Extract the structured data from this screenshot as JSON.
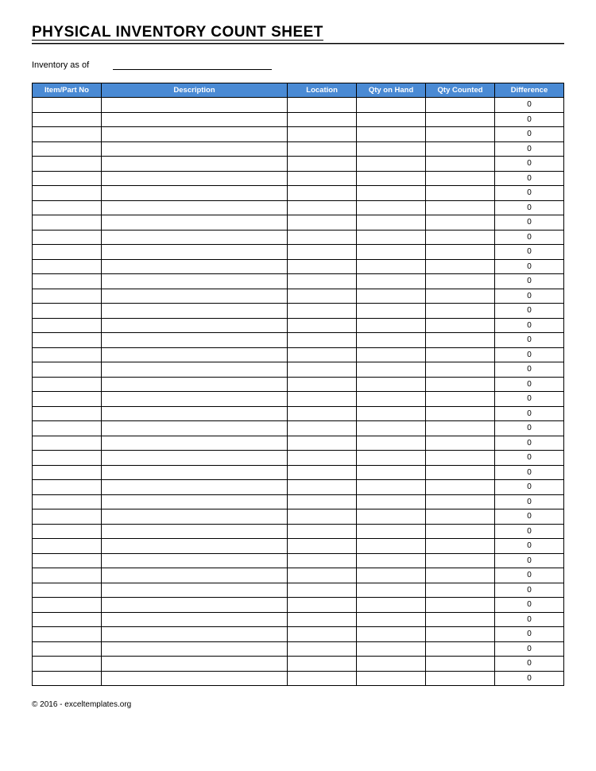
{
  "header": {
    "title": "PHYSICAL INVENTORY COUNT SHEET",
    "asof_label": "Inventory as of",
    "asof_value": ""
  },
  "table": {
    "columns": [
      "Item/Part No",
      "Description",
      "Location",
      "Qty on Hand",
      "Qty Counted",
      "Difference"
    ],
    "rows": [
      {
        "item": "",
        "desc": "",
        "loc": "",
        "qoh": "",
        "qc": "",
        "diff": "0"
      },
      {
        "item": "",
        "desc": "",
        "loc": "",
        "qoh": "",
        "qc": "",
        "diff": "0"
      },
      {
        "item": "",
        "desc": "",
        "loc": "",
        "qoh": "",
        "qc": "",
        "diff": "0"
      },
      {
        "item": "",
        "desc": "",
        "loc": "",
        "qoh": "",
        "qc": "",
        "diff": "0"
      },
      {
        "item": "",
        "desc": "",
        "loc": "",
        "qoh": "",
        "qc": "",
        "diff": "0"
      },
      {
        "item": "",
        "desc": "",
        "loc": "",
        "qoh": "",
        "qc": "",
        "diff": "0"
      },
      {
        "item": "",
        "desc": "",
        "loc": "",
        "qoh": "",
        "qc": "",
        "diff": "0"
      },
      {
        "item": "",
        "desc": "",
        "loc": "",
        "qoh": "",
        "qc": "",
        "diff": "0"
      },
      {
        "item": "",
        "desc": "",
        "loc": "",
        "qoh": "",
        "qc": "",
        "diff": "0"
      },
      {
        "item": "",
        "desc": "",
        "loc": "",
        "qoh": "",
        "qc": "",
        "diff": "0"
      },
      {
        "item": "",
        "desc": "",
        "loc": "",
        "qoh": "",
        "qc": "",
        "diff": "0"
      },
      {
        "item": "",
        "desc": "",
        "loc": "",
        "qoh": "",
        "qc": "",
        "diff": "0"
      },
      {
        "item": "",
        "desc": "",
        "loc": "",
        "qoh": "",
        "qc": "",
        "diff": "0"
      },
      {
        "item": "",
        "desc": "",
        "loc": "",
        "qoh": "",
        "qc": "",
        "diff": "0"
      },
      {
        "item": "",
        "desc": "",
        "loc": "",
        "qoh": "",
        "qc": "",
        "diff": "0"
      },
      {
        "item": "",
        "desc": "",
        "loc": "",
        "qoh": "",
        "qc": "",
        "diff": "0"
      },
      {
        "item": "",
        "desc": "",
        "loc": "",
        "qoh": "",
        "qc": "",
        "diff": "0"
      },
      {
        "item": "",
        "desc": "",
        "loc": "",
        "qoh": "",
        "qc": "",
        "diff": "0"
      },
      {
        "item": "",
        "desc": "",
        "loc": "",
        "qoh": "",
        "qc": "",
        "diff": "0"
      },
      {
        "item": "",
        "desc": "",
        "loc": "",
        "qoh": "",
        "qc": "",
        "diff": "0"
      },
      {
        "item": "",
        "desc": "",
        "loc": "",
        "qoh": "",
        "qc": "",
        "diff": "0"
      },
      {
        "item": "",
        "desc": "",
        "loc": "",
        "qoh": "",
        "qc": "",
        "diff": "0"
      },
      {
        "item": "",
        "desc": "",
        "loc": "",
        "qoh": "",
        "qc": "",
        "diff": "0"
      },
      {
        "item": "",
        "desc": "",
        "loc": "",
        "qoh": "",
        "qc": "",
        "diff": "0"
      },
      {
        "item": "",
        "desc": "",
        "loc": "",
        "qoh": "",
        "qc": "",
        "diff": "0"
      },
      {
        "item": "",
        "desc": "",
        "loc": "",
        "qoh": "",
        "qc": "",
        "diff": "0"
      },
      {
        "item": "",
        "desc": "",
        "loc": "",
        "qoh": "",
        "qc": "",
        "diff": "0"
      },
      {
        "item": "",
        "desc": "",
        "loc": "",
        "qoh": "",
        "qc": "",
        "diff": "0"
      },
      {
        "item": "",
        "desc": "",
        "loc": "",
        "qoh": "",
        "qc": "",
        "diff": "0"
      },
      {
        "item": "",
        "desc": "",
        "loc": "",
        "qoh": "",
        "qc": "",
        "diff": "0"
      },
      {
        "item": "",
        "desc": "",
        "loc": "",
        "qoh": "",
        "qc": "",
        "diff": "0"
      },
      {
        "item": "",
        "desc": "",
        "loc": "",
        "qoh": "",
        "qc": "",
        "diff": "0"
      },
      {
        "item": "",
        "desc": "",
        "loc": "",
        "qoh": "",
        "qc": "",
        "diff": "0"
      },
      {
        "item": "",
        "desc": "",
        "loc": "",
        "qoh": "",
        "qc": "",
        "diff": "0"
      },
      {
        "item": "",
        "desc": "",
        "loc": "",
        "qoh": "",
        "qc": "",
        "diff": "0"
      },
      {
        "item": "",
        "desc": "",
        "loc": "",
        "qoh": "",
        "qc": "",
        "diff": "0"
      },
      {
        "item": "",
        "desc": "",
        "loc": "",
        "qoh": "",
        "qc": "",
        "diff": "0"
      },
      {
        "item": "",
        "desc": "",
        "loc": "",
        "qoh": "",
        "qc": "",
        "diff": "0"
      },
      {
        "item": "",
        "desc": "",
        "loc": "",
        "qoh": "",
        "qc": "",
        "diff": "0"
      },
      {
        "item": "",
        "desc": "",
        "loc": "",
        "qoh": "",
        "qc": "",
        "diff": "0"
      }
    ]
  },
  "footer": {
    "copyright": "© 2016 - exceltemplates.org"
  }
}
